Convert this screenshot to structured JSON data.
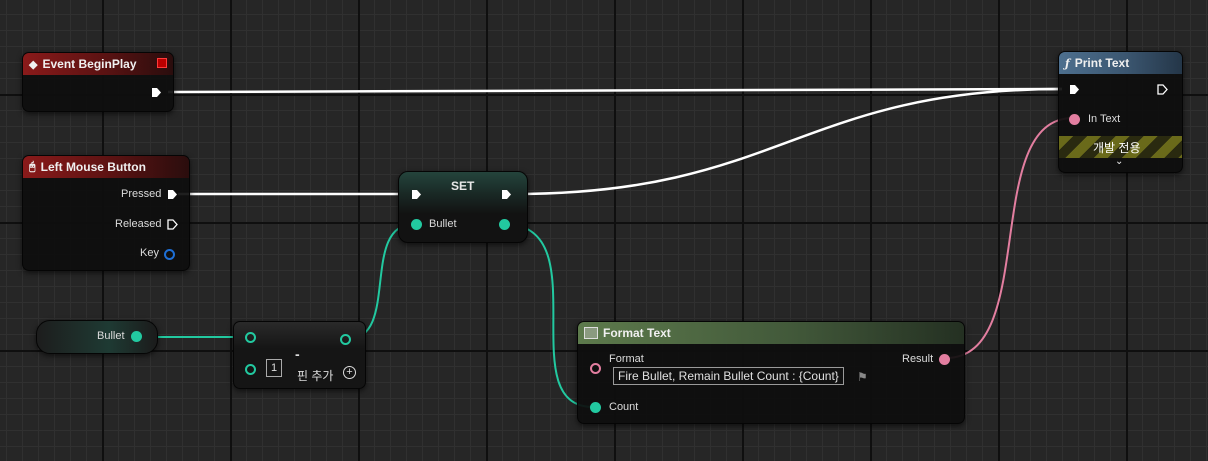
{
  "event_begin_play": {
    "title": "Event BeginPlay",
    "icon": "diamond-event-icon"
  },
  "left_mouse_button": {
    "title": "Left Mouse Button",
    "icon": "mouse-icon",
    "pressed_label": "Pressed",
    "released_label": "Released",
    "key_label": "Key"
  },
  "set_node": {
    "title": "SET",
    "bullet_label": "Bullet"
  },
  "bullet_getter": {
    "label": "Bullet"
  },
  "subtract_node": {
    "operator": "-",
    "value": "1",
    "add_pin_label": "핀 추가"
  },
  "format_text": {
    "title": "Format Text",
    "icon": "format-text-icon",
    "format_label": "Format",
    "format_value": "Fire Bullet, Remain Bullet Count : {Count}",
    "count_label": "Count",
    "result_label": "Result"
  },
  "print_text": {
    "title": "Print Text",
    "icon": "function-icon",
    "in_text_label": "In Text",
    "dev_only_label": "개발 전용"
  },
  "colors": {
    "exec_wire": "#ffffff",
    "integer_wire": "#22c9a0",
    "text_wire": "#e37ea0",
    "event_header": "#8a1a1a",
    "function_header": "#4d6f8e",
    "pure_header": "#5d7a4c"
  }
}
